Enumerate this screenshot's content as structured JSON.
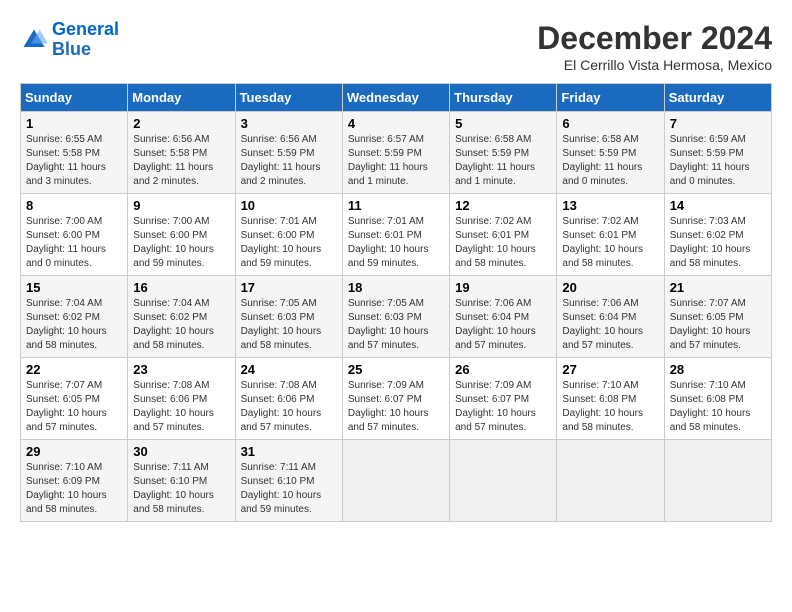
{
  "header": {
    "logo_line1": "General",
    "logo_line2": "Blue",
    "month": "December 2024",
    "location": "El Cerrillo Vista Hermosa, Mexico"
  },
  "weekdays": [
    "Sunday",
    "Monday",
    "Tuesday",
    "Wednesday",
    "Thursday",
    "Friday",
    "Saturday"
  ],
  "weeks": [
    [
      {
        "day": "1",
        "sunrise": "6:55 AM",
        "sunset": "5:58 PM",
        "daylight": "11 hours and 3 minutes."
      },
      {
        "day": "2",
        "sunrise": "6:56 AM",
        "sunset": "5:58 PM",
        "daylight": "11 hours and 2 minutes."
      },
      {
        "day": "3",
        "sunrise": "6:56 AM",
        "sunset": "5:59 PM",
        "daylight": "11 hours and 2 minutes."
      },
      {
        "day": "4",
        "sunrise": "6:57 AM",
        "sunset": "5:59 PM",
        "daylight": "11 hours and 1 minute."
      },
      {
        "day": "5",
        "sunrise": "6:58 AM",
        "sunset": "5:59 PM",
        "daylight": "11 hours and 1 minute."
      },
      {
        "day": "6",
        "sunrise": "6:58 AM",
        "sunset": "5:59 PM",
        "daylight": "11 hours and 0 minutes."
      },
      {
        "day": "7",
        "sunrise": "6:59 AM",
        "sunset": "5:59 PM",
        "daylight": "11 hours and 0 minutes."
      }
    ],
    [
      {
        "day": "8",
        "sunrise": "7:00 AM",
        "sunset": "6:00 PM",
        "daylight": "11 hours and 0 minutes."
      },
      {
        "day": "9",
        "sunrise": "7:00 AM",
        "sunset": "6:00 PM",
        "daylight": "10 hours and 59 minutes."
      },
      {
        "day": "10",
        "sunrise": "7:01 AM",
        "sunset": "6:00 PM",
        "daylight": "10 hours and 59 minutes."
      },
      {
        "day": "11",
        "sunrise": "7:01 AM",
        "sunset": "6:01 PM",
        "daylight": "10 hours and 59 minutes."
      },
      {
        "day": "12",
        "sunrise": "7:02 AM",
        "sunset": "6:01 PM",
        "daylight": "10 hours and 58 minutes."
      },
      {
        "day": "13",
        "sunrise": "7:02 AM",
        "sunset": "6:01 PM",
        "daylight": "10 hours and 58 minutes."
      },
      {
        "day": "14",
        "sunrise": "7:03 AM",
        "sunset": "6:02 PM",
        "daylight": "10 hours and 58 minutes."
      }
    ],
    [
      {
        "day": "15",
        "sunrise": "7:04 AM",
        "sunset": "6:02 PM",
        "daylight": "10 hours and 58 minutes."
      },
      {
        "day": "16",
        "sunrise": "7:04 AM",
        "sunset": "6:02 PM",
        "daylight": "10 hours and 58 minutes."
      },
      {
        "day": "17",
        "sunrise": "7:05 AM",
        "sunset": "6:03 PM",
        "daylight": "10 hours and 58 minutes."
      },
      {
        "day": "18",
        "sunrise": "7:05 AM",
        "sunset": "6:03 PM",
        "daylight": "10 hours and 57 minutes."
      },
      {
        "day": "19",
        "sunrise": "7:06 AM",
        "sunset": "6:04 PM",
        "daylight": "10 hours and 57 minutes."
      },
      {
        "day": "20",
        "sunrise": "7:06 AM",
        "sunset": "6:04 PM",
        "daylight": "10 hours and 57 minutes."
      },
      {
        "day": "21",
        "sunrise": "7:07 AM",
        "sunset": "6:05 PM",
        "daylight": "10 hours and 57 minutes."
      }
    ],
    [
      {
        "day": "22",
        "sunrise": "7:07 AM",
        "sunset": "6:05 PM",
        "daylight": "10 hours and 57 minutes."
      },
      {
        "day": "23",
        "sunrise": "7:08 AM",
        "sunset": "6:06 PM",
        "daylight": "10 hours and 57 minutes."
      },
      {
        "day": "24",
        "sunrise": "7:08 AM",
        "sunset": "6:06 PM",
        "daylight": "10 hours and 57 minutes."
      },
      {
        "day": "25",
        "sunrise": "7:09 AM",
        "sunset": "6:07 PM",
        "daylight": "10 hours and 57 minutes."
      },
      {
        "day": "26",
        "sunrise": "7:09 AM",
        "sunset": "6:07 PM",
        "daylight": "10 hours and 57 minutes."
      },
      {
        "day": "27",
        "sunrise": "7:10 AM",
        "sunset": "6:08 PM",
        "daylight": "10 hours and 58 minutes."
      },
      {
        "day": "28",
        "sunrise": "7:10 AM",
        "sunset": "6:08 PM",
        "daylight": "10 hours and 58 minutes."
      }
    ],
    [
      {
        "day": "29",
        "sunrise": "7:10 AM",
        "sunset": "6:09 PM",
        "daylight": "10 hours and 58 minutes."
      },
      {
        "day": "30",
        "sunrise": "7:11 AM",
        "sunset": "6:10 PM",
        "daylight": "10 hours and 58 minutes."
      },
      {
        "day": "31",
        "sunrise": "7:11 AM",
        "sunset": "6:10 PM",
        "daylight": "10 hours and 59 minutes."
      },
      null,
      null,
      null,
      null
    ]
  ]
}
